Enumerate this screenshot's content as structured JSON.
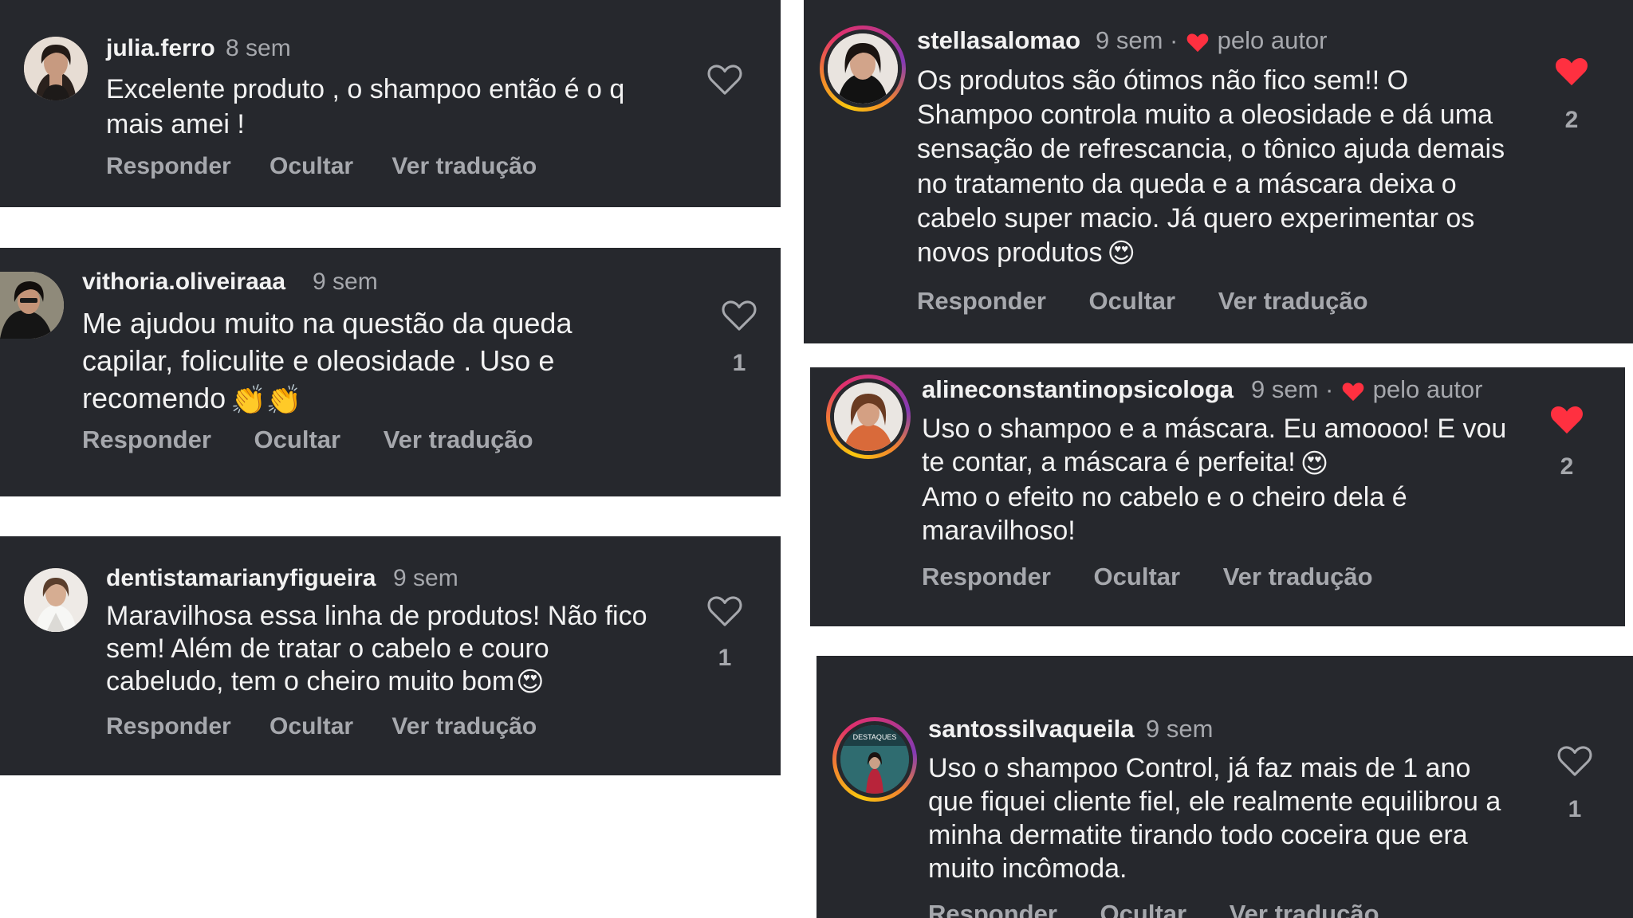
{
  "comments": [
    {
      "username": "julia.ferro",
      "time": "8 sem",
      "text": "Excelente produto , o shampoo então é o q mais amei !",
      "emoji": "",
      "actions": [
        "Responder",
        "Ocultar",
        "Ver tradução"
      ],
      "likes": "",
      "liked": false,
      "author_liked": false,
      "avatar_ring": false
    },
    {
      "username": "vithoria.oliveiraaa",
      "time": "9 sem",
      "text": "Me ajudou muito na questão da queda capilar, foliculite e oleosidade . Uso e recomendo",
      "emoji": "👏👏",
      "actions": [
        "Responder",
        "Ocultar",
        "Ver tradução"
      ],
      "likes": "1",
      "liked": false,
      "author_liked": false,
      "avatar_ring": false
    },
    {
      "username": "dentistamarianyfigueira",
      "time": "9 sem",
      "text": "Maravilhosa essa linha de produtos! Não fico sem! Além de tratar o cabelo e couro cabeludo, tem o cheiro muito bom",
      "emoji": "😍",
      "actions": [
        "Responder",
        "Ocultar",
        "Ver tradução"
      ],
      "likes": "1",
      "liked": false,
      "author_liked": false,
      "avatar_ring": false
    },
    {
      "username": "stellasalomao",
      "time": "9 sem",
      "author_label": "pelo autor",
      "text": "Os produtos são ótimos não fico sem!! O Shampoo controla muito a oleosidade e dá uma sensação de refrescancia, o tônico ajuda demais no tratamento da queda e a máscara deixa o cabelo super macio. Já quero experimentar os novos produtos",
      "emoji": "😍",
      "actions": [
        "Responder",
        "Ocultar",
        "Ver tradução"
      ],
      "likes": "2",
      "liked": true,
      "author_liked": true,
      "avatar_ring": true
    },
    {
      "username": "alineconstantinopsicologa",
      "time": "9 sem",
      "author_label": "pelo autor",
      "text": "Uso o shampoo e a máscara. Eu amoooo! E vou te contar, a máscara é perfeita!",
      "emoji": "😍",
      "text2": "Amo o efeito no cabelo e o cheiro dela é maravilhoso!",
      "actions": [
        "Responder",
        "Ocultar",
        "Ver tradução"
      ],
      "likes": "2",
      "liked": true,
      "author_liked": true,
      "avatar_ring": true
    },
    {
      "username": "santossilvaqueila",
      "time": "9 sem",
      "text": "Uso o shampoo Control, já faz mais de 1 ano que fiquei cliente fiel, ele realmente equilibrou a minha dermatite tirando todo coceira que era muito incômoda.",
      "emoji": "",
      "actions": [
        "Responder",
        "Ocultar",
        "Ver tradução"
      ],
      "likes": "1",
      "liked": false,
      "author_liked": false,
      "avatar_ring": true,
      "avatar_text": "DESTAQUES"
    }
  ],
  "colors": {
    "card_bg": "#26282d",
    "text": "#f2f2f2",
    "muted": "#a6a8ad",
    "heart_red": "#ff3040"
  }
}
